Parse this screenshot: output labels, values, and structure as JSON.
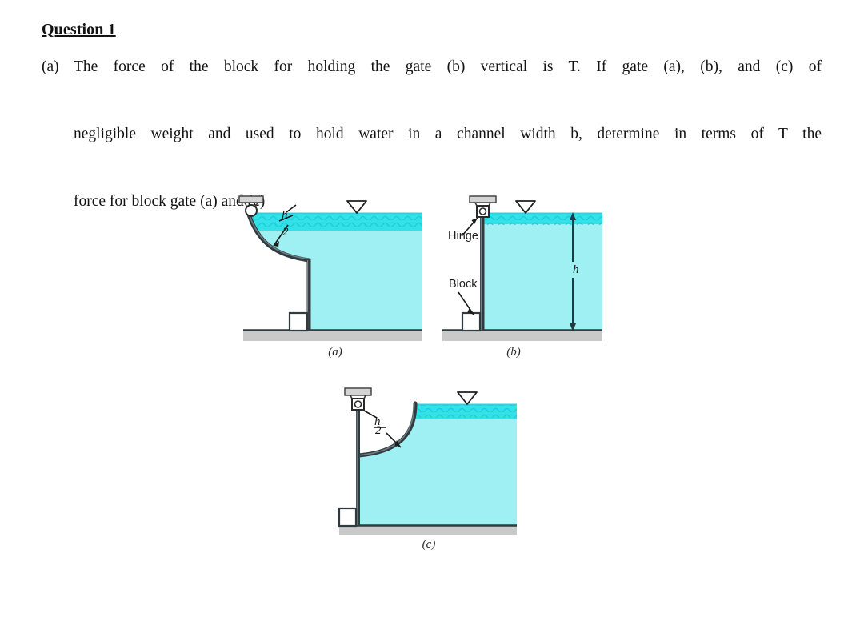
{
  "document": {
    "title": "Question 1",
    "question": {
      "marker": "(a)",
      "lines": [
        "The force of the block for holding the gate (b) vertical is T.   If gate (a), (b), and (c) of",
        "negligible weight and used to hold water in a channel width b, determine in terms of T the",
        "force for block gate (a) and (c)"
      ]
    }
  },
  "figures": {
    "colors": {
      "water_fill": "#9ff0f3",
      "water_surface": "#33e2e8",
      "ground": "#c9c9c9",
      "gate_dark": "#2f3b3f",
      "bracket": "#d4d4d4",
      "outline": "#1f1f1f"
    },
    "a": {
      "caption": "(a)",
      "dimension_numerator": "h",
      "dimension_denominator": "2"
    },
    "b": {
      "caption": "(b)",
      "hinge_label": "Hinge",
      "block_label": "Block",
      "depth_label": "h"
    },
    "c": {
      "caption": "(c)",
      "dimension_numerator": "h",
      "dimension_denominator": "2"
    }
  }
}
